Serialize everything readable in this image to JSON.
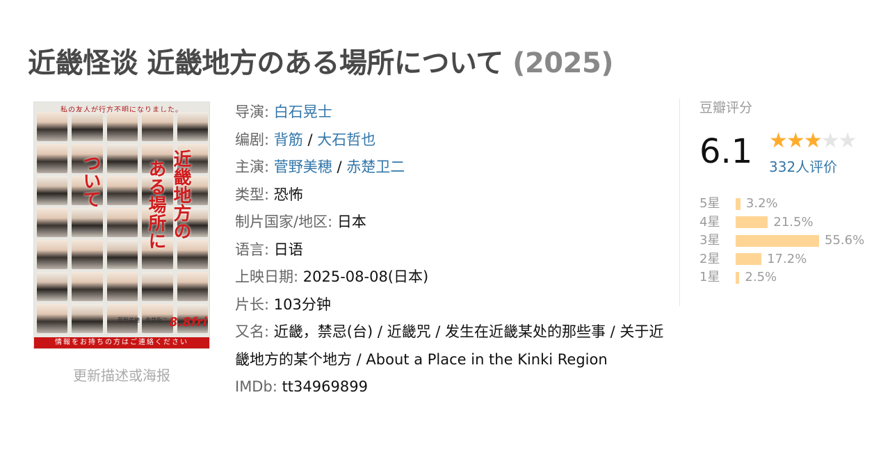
{
  "title": {
    "main": "近畿怪谈 近畿地方のある場所について",
    "year": "(2025)"
  },
  "poster": {
    "top_text": "私の友人が行方不明になりました。",
    "kana_col1": "近畿地方の",
    "kana_col2": "ある場所に",
    "kana_col3": "ついて",
    "cast": "菅野美穂　赤楚衛二",
    "date": "8.8fri",
    "bottom_text": "情報をお持ちの方はご連絡ください"
  },
  "update_link": "更新描述或海报",
  "info": {
    "director_label": "导演",
    "director": "白石晃士",
    "writer_label": "编剧",
    "writers": [
      "背筋",
      "大石哲也"
    ],
    "cast_label": "主演",
    "cast": [
      "菅野美穂",
      "赤楚卫二"
    ],
    "genre_label": "类型:",
    "genre": "恐怖",
    "country_label": "制片国家/地区:",
    "country": "日本",
    "language_label": "语言:",
    "language": "日语",
    "release_label": "上映日期:",
    "release": "2025-08-08(日本)",
    "runtime_label": "片长:",
    "runtime": "103分钟",
    "aka_label": "又名:",
    "aka": "近畿，禁忌(台) / 近畿咒 / 发生在近畿某处的那些事 / 关于近畿地方的某个地方 / About a Place in the Kinki Region",
    "imdb_label": "IMDb:",
    "imdb": "tt34969899"
  },
  "rating": {
    "label": "豆瓣评分",
    "score": "6.1",
    "stars_filled": 3,
    "stars_total": 5,
    "votes": "332人评价",
    "distribution": [
      {
        "label": "5星",
        "percent": 3.2,
        "text": "3.2%"
      },
      {
        "label": "4星",
        "percent": 21.5,
        "text": "21.5%"
      },
      {
        "label": "3星",
        "percent": 55.6,
        "text": "55.6%"
      },
      {
        "label": "2星",
        "percent": 17.2,
        "text": "17.2%"
      },
      {
        "label": "1星",
        "percent": 2.5,
        "text": "2.5%"
      }
    ],
    "colors": {
      "star_on": "#ffac2d",
      "star_off": "#e5e5e5",
      "bar": "#ffd596",
      "link": "#3377aa"
    }
  }
}
